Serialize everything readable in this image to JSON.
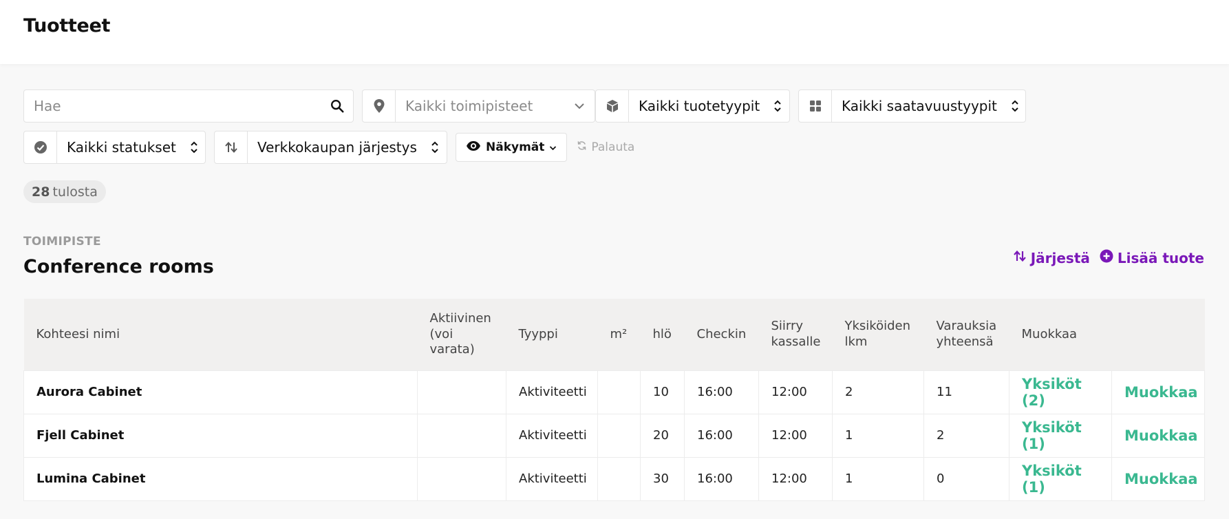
{
  "page": {
    "title": "Tuotteet"
  },
  "filters": {
    "search_placeholder": "Hae",
    "location": "Kaikki toimipisteet",
    "product_type": "Kaikki tuotetyypit",
    "availability": "Kaikki saatavuustyypit",
    "status": "Kaikki statukset",
    "order": "Verkkokaupan järjestys",
    "views_label": "Näkymät",
    "reset_label": "Palauta"
  },
  "results": {
    "count": "28",
    "label": "tulosta"
  },
  "section": {
    "label": "TOIMIPISTE",
    "title": "Conference rooms",
    "sort_label": "Järjestä",
    "add_label": "Lisää tuote"
  },
  "table": {
    "headers": [
      "Kohteesi nimi",
      "Aktiivinen (voi varata)",
      "Tyyppi",
      "m²",
      "hlö",
      "Checkin",
      "Siirry kassalle",
      "Yksiköiden lkm",
      "Varauksia yhteensä",
      "Muokkaa",
      ""
    ],
    "rows": [
      {
        "name": "Aurora Cabinet",
        "active": "",
        "type": "Aktiviteetti",
        "m2": "",
        "persons": "10",
        "checkin": "16:00",
        "checkout": "12:00",
        "units": "2",
        "bookings": "11",
        "units_link": "Yksiköt (2)",
        "edit_link": "Muokkaa"
      },
      {
        "name": "Fjell Cabinet",
        "active": "",
        "type": "Aktiviteetti",
        "m2": "",
        "persons": "20",
        "checkin": "16:00",
        "checkout": "12:00",
        "units": "1",
        "bookings": "2",
        "units_link": "Yksiköt (1)",
        "edit_link": "Muokkaa"
      },
      {
        "name": "Lumina Cabinet",
        "active": "",
        "type": "Aktiviteetti",
        "m2": "",
        "persons": "30",
        "checkin": "16:00",
        "checkout": "12:00",
        "units": "1",
        "bookings": "0",
        "units_link": "Yksiköt (1)",
        "edit_link": "Muokkaa"
      }
    ]
  },
  "colors": {
    "accent": "#7a18b8",
    "link_green": "#3ab890",
    "header_bg": "#f1f0ef"
  },
  "icons": [
    "search-icon",
    "map-pin-icon",
    "chevron-down-icon",
    "box-icon",
    "sort-arrows-icon",
    "grid-icon",
    "check-circle-icon",
    "swap-vertical-icon",
    "eye-icon",
    "refresh-icon",
    "plus-circle-icon"
  ]
}
